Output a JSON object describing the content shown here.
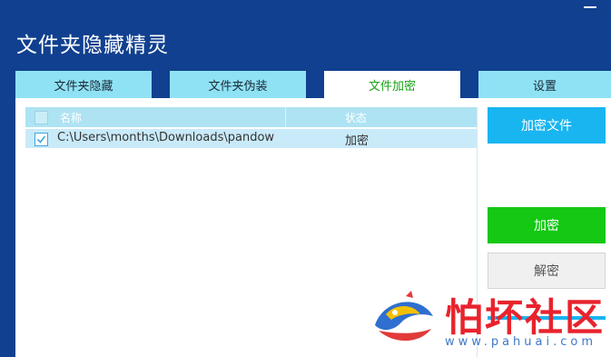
{
  "app": {
    "title": "文件夹隐藏精灵"
  },
  "tabs": [
    {
      "label": "文件夹隐藏"
    },
    {
      "label": "文件夹伪装"
    },
    {
      "label": "文件加密",
      "active": true
    },
    {
      "label": "设置"
    }
  ],
  "list": {
    "columns": {
      "name": "名称",
      "status": "状态"
    },
    "rows": [
      {
        "checked": true,
        "path": "C:\\Users\\months\\Downloads\\pandow",
        "status": "加密"
      }
    ]
  },
  "actions": {
    "add_file_label": "加密文件",
    "encrypt_label": "加密",
    "decrypt_label": "解密"
  },
  "watermark": {
    "title": "怕坏社区",
    "url": "www.pahuai.com"
  },
  "colors": {
    "window_bg": "#10408f",
    "tab_bg": "#8fe2f4",
    "active_tab_text": "#18a318",
    "primary_blue": "#19b5f0",
    "encrypt_green": "#14c814"
  }
}
